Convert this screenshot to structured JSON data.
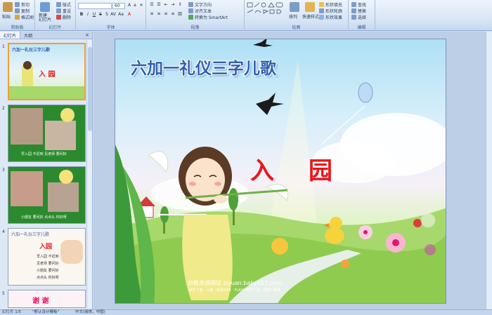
{
  "ribbon": {
    "clipboard": {
      "paste": "粘贴",
      "cut": "剪切",
      "copy": "复制",
      "format_painter": "格式刷",
      "label": "剪贴板"
    },
    "slides": {
      "new_slide": "新建\n幻灯片",
      "layout": "版式",
      "reset": "重设",
      "delete": "删除",
      "label": "幻灯片"
    },
    "font": {
      "size": "60",
      "label": "字体"
    },
    "paragraph": {
      "text_direction": "文字方向",
      "align_text": "对齐文本",
      "smartart": "转换为 SmartArt",
      "label": "段落"
    },
    "drawing": {
      "arrange": "排列",
      "quick_styles": "快速样式",
      "shape_fill": "形状填充",
      "shape_outline": "形状轮廓",
      "shape_effects": "形状效果",
      "label": "绘图"
    },
    "editing": {
      "find": "查找",
      "replace": "替换",
      "select": "选择",
      "label": "编辑"
    }
  },
  "panel": {
    "tab_slides": "幻灯片",
    "tab_outline": "大纲",
    "close": "×",
    "thumbnails": [
      {
        "num": "1",
        "title": "六加一礼仪三字儿歌",
        "heading": "入  园"
      },
      {
        "num": "2",
        "caption": "早入园  不迟到  见老师  要问好"
      },
      {
        "num": "3",
        "caption": "小朋友  要问好  点点头  你好呀"
      },
      {
        "num": "4",
        "title": "六加一礼仪三字儿歌",
        "heading": "入园",
        "lines": [
          "早入园  不迟到",
          "见老师  要问好",
          "小朋友  要问好",
          "点点头  你好呀"
        ]
      },
      {
        "num": "5",
        "heading": "谢  谢"
      }
    ]
  },
  "slide": {
    "title": "六加一礼仪三字儿歌",
    "heading_1": "入",
    "heading_2": "园",
    "site": "幼教资源网站  ziyuan.baby611.com",
    "subsite": "课件下载 · 儿歌 · 故事MP3 · FLASH课件下载 · 试卷下载等"
  },
  "status": {
    "slide_count": "幻灯片 1/5",
    "theme": "\"默认设计模板\"",
    "language": "中文(简体，中国)"
  },
  "colors": {
    "title": "#2f5fae",
    "heading": "#e8161a",
    "selection": "#f0a030"
  }
}
